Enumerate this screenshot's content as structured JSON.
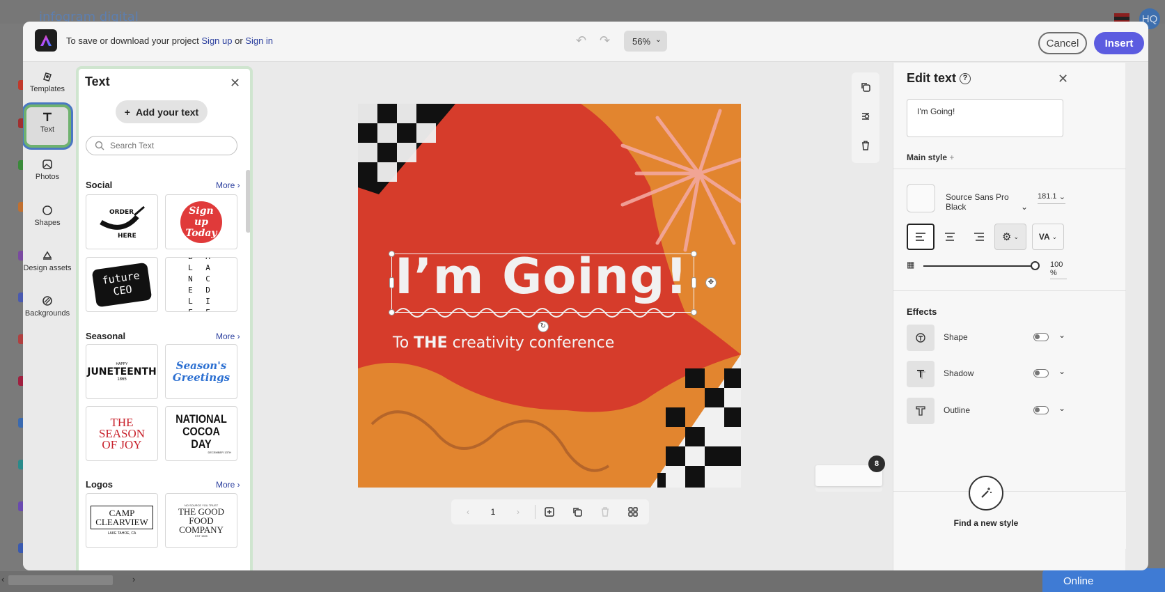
{
  "background": {
    "brand_text": "infogram digital",
    "avatar_initials": "HQ",
    "online_label": "Online"
  },
  "topbar": {
    "save_prefix": "To save or download your project ",
    "sign_up": "Sign up",
    "or_text": " or ",
    "sign_in": "Sign in",
    "zoom": "56%",
    "cancel_label": "Cancel",
    "insert_label": "Insert"
  },
  "rail": [
    {
      "label": "Templates",
      "icon": "templates-icon"
    },
    {
      "label": "Text",
      "icon": "text-icon"
    },
    {
      "label": "Photos",
      "icon": "photos-icon"
    },
    {
      "label": "Shapes",
      "icon": "shapes-icon"
    },
    {
      "label": "Design assets",
      "icon": "design-assets-icon"
    },
    {
      "label": "Backgrounds",
      "icon": "backgrounds-icon"
    }
  ],
  "text_panel": {
    "title": "Text",
    "add_text_label": "Add your text",
    "search_placeholder": "Search Text",
    "sections": [
      {
        "title": "Social",
        "more": "More"
      },
      {
        "title": "Seasonal",
        "more": "More"
      },
      {
        "title": "Logos",
        "more": "More"
      }
    ],
    "tiles": {
      "order_here": "ORDER HERE",
      "sign_up_today": "Sign up Today",
      "future_ceo": "future CEO",
      "balanced_life": "B A L A N C E D L I F E",
      "juneteenth": "JUNETEENTH",
      "juneteenth_top": "HAPPY",
      "juneteenth_sub": "1865",
      "seasons_greetings": "Season's Greetings",
      "season_joy": "THE SEASON OF JOY",
      "cocoa": "NATIONAL COCOA DAY",
      "cocoa_sub": "DECEMBER 13TH",
      "camp": "CAMP CLEARVIEW",
      "camp_sub": "LAKE TAHOE, CA",
      "food": "THE GOOD FOOD COMPANY",
      "food_top": "NO SOURCE YOU TRUST",
      "food_sub": "EST 1985"
    }
  },
  "canvas": {
    "headline": "I’m Going!",
    "sub_prefix": "To ",
    "sub_bold": "THE",
    "sub_suffix": " creativity conference",
    "colors": {
      "red": "#d63c2b",
      "orange": "#e2852f",
      "light": "#f1f1f1",
      "dark": "#111111"
    }
  },
  "pager": {
    "page_number": "1",
    "pages_count": "8"
  },
  "edit_panel": {
    "title": "Edit text",
    "text_value": "I'm Going!",
    "main_style": "Main style",
    "font": "Source Sans Pro Black",
    "size": "181.1",
    "opacity": "100 %",
    "opacity_level": 1.0,
    "effects_title": "Effects",
    "effects": [
      {
        "label": "Shape",
        "icon": "shape-effect-icon",
        "enabled": false
      },
      {
        "label": "Shadow",
        "icon": "shadow-effect-icon",
        "enabled": false
      },
      {
        "label": "Outline",
        "icon": "outline-effect-icon",
        "enabled": false
      }
    ],
    "find_style": "Find a new style"
  }
}
